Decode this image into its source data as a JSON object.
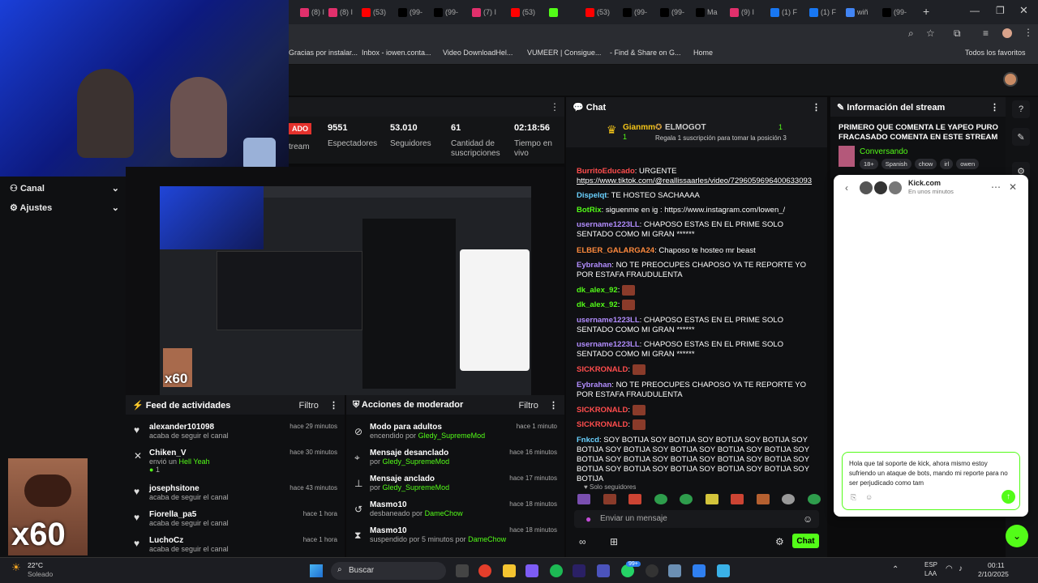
{
  "browser": {
    "tabs": [
      "(8) I",
      "(8) I",
      "(53)",
      "(99-",
      "(99-",
      "(7) I",
      "(53)",
      "",
      "(53)",
      "(99-",
      "(99-",
      "Ma",
      "(9) I",
      "(1) F",
      "(1) F",
      "wiñ",
      "(99-"
    ],
    "bookmarks": [
      "Gracias por instalar...",
      "Inbox - iowen.conta...",
      "Video DownloadHel...",
      "VUMEER | Consigue...",
      "- Find & Share on G...",
      "Home",
      "Todos los favoritos"
    ]
  },
  "sidebar": {
    "items": [
      {
        "label": "Canal"
      },
      {
        "label": "Ajustes"
      }
    ]
  },
  "stream_stats": {
    "live_badge": "ADO",
    "stream_label": "tream",
    "items": [
      {
        "value": "9551",
        "label": "Espectadores"
      },
      {
        "value": "53.010",
        "label": "Seguidores"
      },
      {
        "value": "61",
        "label": "Cantidad de suscripciones"
      },
      {
        "value": "02:18:56",
        "label": "Tiempo en vivo"
      }
    ],
    "preview_overlay": "x60"
  },
  "activity_feed": {
    "title": "Feed de actividades",
    "filter": "Filtro",
    "items": [
      {
        "name": "alexander101098",
        "sub": "acaba de seguir el canal",
        "time": "hace 29 minutos"
      },
      {
        "name": "Chiken_V",
        "sub_prefix": "envió un",
        "sub_highlight": "Hell Yeah",
        "count": "1",
        "time": "hace 30 minutos"
      },
      {
        "name": "josephsitone",
        "sub": "acaba de seguir el canal",
        "time": "hace 43 minutos"
      },
      {
        "name": "Fiorella_pa5",
        "sub": "acaba de seguir el canal",
        "time": "hace 1 hora"
      },
      {
        "name": "LuchoCz",
        "sub": "acaba de seguir el canal",
        "time": "hace 1 hora"
      }
    ]
  },
  "mod_actions": {
    "title": "Acciones de moderador",
    "filter": "Filtro",
    "items": [
      {
        "title": "Modo para adultos",
        "sub_prefix": "encendido por",
        "by": "Gledy_SupremeMod",
        "time": "hace 1 minuto"
      },
      {
        "title": "Mensaje desanclado",
        "sub_prefix": "por",
        "by": "Gledy_SupremeMod",
        "time": "hace 16 minutos"
      },
      {
        "title": "Mensaje anclado",
        "sub_prefix": "por",
        "by": "Gledy_SupremeMod",
        "time": "hace 17 minutos"
      },
      {
        "title": "Masmo10",
        "sub_prefix": "desbaneado por",
        "by": "DameChow",
        "time": "hace 18 minutos"
      },
      {
        "title": "Masmo10",
        "sub_prefix": "suspendido por 5 minutos por",
        "by": "DameChow",
        "time": "hace 18 minutos"
      }
    ]
  },
  "chat": {
    "title": "Chat",
    "top_gifter": {
      "name": "Gianmm",
      "count": "1",
      "rank": "1"
    },
    "pinned": {
      "name": "ELMOGOT",
      "count": "1",
      "text": "Regala 1 suscripción para tomar la posición 3"
    },
    "messages": [
      {
        "user": "BurritoEducado",
        "color": "#ff4d4d",
        "text": ": URGENTE"
      },
      {
        "user": "",
        "color": "#fff",
        "text": "https://www.tiktok.com/@reallissaarles/video/7296059696400633093"
      },
      {
        "user": "Dispelqt",
        "color": "#6ad1ff",
        "text": ": TE HOSTEO SACHAAAA"
      },
      {
        "user": "BotRix",
        "color": "#53fc18",
        "text": ": siguenme en ig : https://www.instagram.com/lowen_/"
      },
      {
        "user": "username1223LL",
        "color": "#b28dff",
        "text": ": CHAPOSO ESTAS EN EL PRIME SOLO SENTADO COMO MI GRAN ******"
      },
      {
        "user": "ELBER_GALARGA24",
        "color": "#ff8a3d",
        "text": ": Chaposo te hosteo mr beast"
      },
      {
        "user": "Eybrahan",
        "color": "#b28dff",
        "text": ": NO TE PREOCUPES CHAPOSO YA TE REPORTE YO POR ESTAFA FRAUDULENTA"
      },
      {
        "user": "dk_alex_92",
        "color": "#53fc18",
        "text": ":"
      },
      {
        "user": "dk_alex_92",
        "color": "#53fc18",
        "text": ":"
      },
      {
        "user": "username1223LL",
        "color": "#b28dff",
        "text": ": CHAPOSO ESTAS EN EL PRIME SOLO SENTADO COMO MI GRAN ******"
      },
      {
        "user": "username1223LL",
        "color": "#b28dff",
        "text": ": CHAPOSO ESTAS EN EL PRIME SOLO SENTADO COMO MI GRAN ******"
      },
      {
        "user": "SICKRONALD",
        "color": "#ff4d4d",
        "text": ":"
      },
      {
        "user": "Eybrahan",
        "color": "#b28dff",
        "text": ": NO TE PREOCUPES CHAPOSO YA TE REPORTE YO POR ESTAFA FRAUDULENTA"
      },
      {
        "user": "SICKRONALD",
        "color": "#ff4d4d",
        "text": ":"
      },
      {
        "user": "SICKRONALD",
        "color": "#ff4d4d",
        "text": ":"
      },
      {
        "user": "Fnkcd",
        "color": "#6ad1ff",
        "text": ": SOY BOTIJA SOY BOTIJA SOY BOTIJA SOY BOTIJA SOY BOTIJA SOY BOTIJA SOY BOTIJA SOY BOTIJA SOY BOTIJA SOY BOTIJA SOY BOTIJA SOY BOTIJA SOY BOTIJA SOY BOTIJA SOY BOTIJA SOY BOTIJA SOY BOTIJA SOY BOTIJA SOY BOTIJA SOY BOTIJA"
      }
    ],
    "followers_only": "Solo seguidores",
    "input_placeholder": "Enviar un mensaje",
    "send_label": "Chat"
  },
  "stream_info": {
    "title": "Información del stream",
    "stream_title": "PRIMERO QUE COMENTA LE YAPEO PURO FRACASADO COMENTA EN ESTE STREAM",
    "category": "Conversando",
    "tags": [
      "18+",
      "Spanish",
      "chow",
      "irl",
      "owen"
    ]
  },
  "support_widget": {
    "title": "Kick.com",
    "subtitle": "En unos minutos",
    "draft": "Hola que tal soporte de kick, ahora mismo estoy sufriendo un ataque de bots, mando mi reporte para no ser perjudicado como tam"
  },
  "webcam": {
    "overlay": "x60"
  },
  "taskbar": {
    "weather_temp": "22°C",
    "weather_desc": "Soleado",
    "search_placeholder": "Buscar",
    "badge": "99+",
    "lang": "ESP",
    "lang_sub": "LAA",
    "time": "00:11",
    "date": "2/10/2025"
  },
  "colors": {
    "kick_green": "#53fc18",
    "panel_bg": "#18191c",
    "page_bg": "#0b0b0c"
  }
}
